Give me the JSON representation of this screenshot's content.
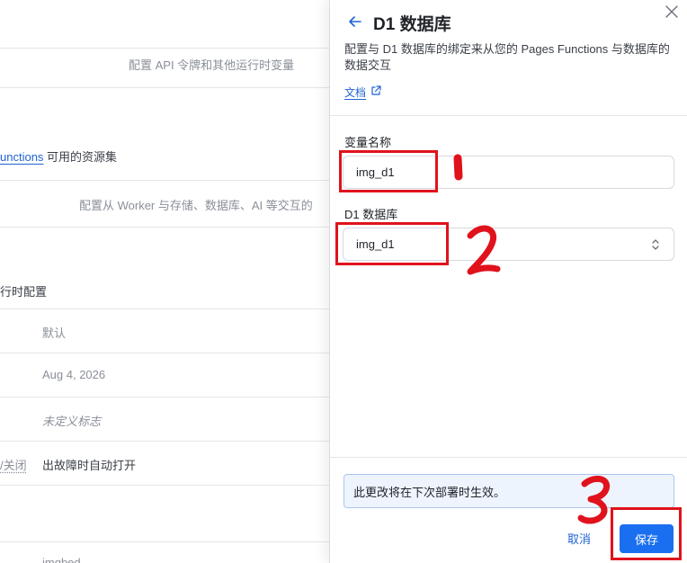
{
  "background": {
    "api_tokens_desc": "配置 API 令牌和其他运行时变量",
    "functions_link": "unctions",
    "functions_suffix": "可用的资源集",
    "bindings_desc": "配置从 Worker 与存储、数据库、AI 等交互的",
    "runtime_config": "运行时配置",
    "rows": [
      {
        "value": "默认"
      },
      {
        "value": "Aug 4, 2026"
      },
      {
        "value": "未定义标志"
      },
      {
        "label": "/关闭",
        "value": "出故障时自动打开"
      },
      {
        "value": "imgbed"
      }
    ]
  },
  "drawer": {
    "title": "D1 数据库",
    "description": "配置与 D1 数据库的绑定来从您的 Pages Functions 与数据库的数据交互",
    "docs_link": "文档",
    "variable_name_label": "变量名称",
    "variable_name_value": "img_d1",
    "database_label": "D1 数据库",
    "database_selected": "img_d1",
    "notice": "此更改将在下次部署时生效。",
    "cancel_label": "取消",
    "save_label": "保存"
  },
  "icons": {
    "back": "arrow-left-icon",
    "close": "close-icon",
    "external": "external-link-icon",
    "chevron": "chevron-up-down-icon"
  },
  "colors": {
    "accent": "#1a6ff0",
    "link": "#1f62d4",
    "annotation": "#e0121c",
    "notice_bg": "#eef4fd",
    "notice_border": "#a9c6ee"
  },
  "annotations": [
    "1",
    "2",
    "3"
  ]
}
